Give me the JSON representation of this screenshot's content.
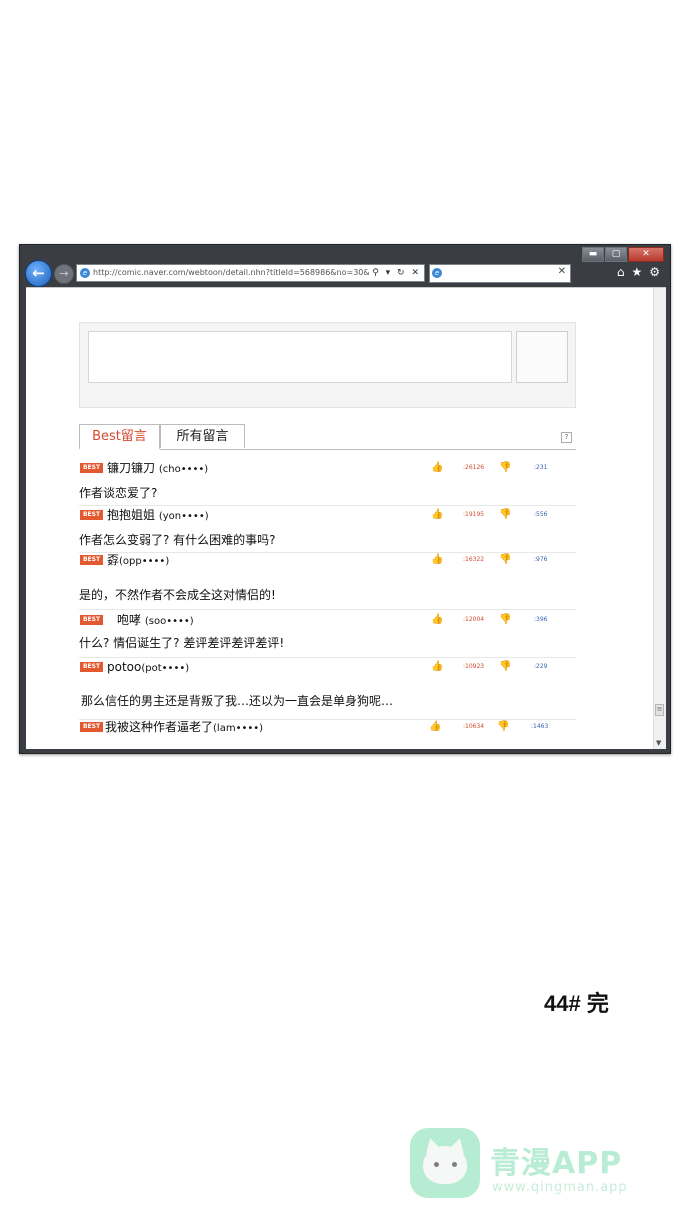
{
  "browser": {
    "url": "http://comic.naver.com/webtoon/detail.nhn?titleId=568986&no=30&we",
    "address_controls": "⚲ ▾ ↻ ✕",
    "tab_close": "✕",
    "window_buttons": {
      "minimize": "▬",
      "maximize": "▢",
      "close": "✕"
    },
    "tool_icons": {
      "home": "⌂",
      "favorites": "★",
      "settings": "⚙"
    }
  },
  "comments": {
    "tabs": [
      {
        "label": "Best留言",
        "active": true
      },
      {
        "label": "所有留言",
        "active": false
      }
    ],
    "help": "?",
    "badge": "BEST",
    "items": [
      {
        "author": "镰刀镰刀",
        "id": "(cho••••)",
        "text": "作者谈恋爱了?",
        "likes": ":26126",
        "dislikes": ":231"
      },
      {
        "author": "抱抱姐姐",
        "id": "(yon••••)",
        "text": "作者怎么变弱了? 有什么困难的事吗?",
        "likes": ":19195",
        "dislikes": ":556"
      },
      {
        "author": "孬",
        "id": "(opp••••)",
        "text": "是的，不然作者不会成全这对情侣的!",
        "likes": ":16322",
        "dislikes": ":976"
      },
      {
        "author": "咆哮",
        "id": "(soo••••)",
        "text": "什么? 情侣诞生了? 差评差评差评差评!",
        "likes": ":12004",
        "dislikes": ":396"
      },
      {
        "author": "potoo",
        "id": "(pot••••)",
        "text": "那么信任的男主还是背叛了我…还以为一直会是单身狗呢…",
        "likes": ":10923",
        "dislikes": ":229"
      },
      {
        "author": "我被这种作者逼老了",
        "id": "(lam••••)",
        "text": "",
        "likes": ":10634",
        "dislikes": ":1463"
      }
    ]
  },
  "ending_text": "44# 完",
  "watermark": {
    "brand": "青漫APP",
    "url": "www.qingman.app"
  },
  "colors": {
    "accent_red": "#d44a2f",
    "badge_orange": "#e2582f",
    "dislike_blue": "#3a63b3",
    "window_frame": "#3a3d42",
    "watermark_green": "#9ee7c3"
  }
}
